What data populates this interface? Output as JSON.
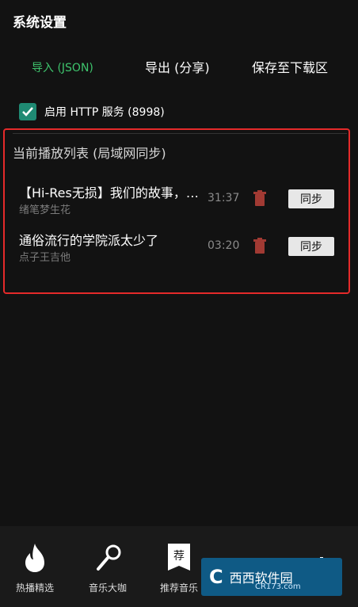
{
  "header": {
    "title": "系统设置"
  },
  "tabs": [
    {
      "label": "导入 (JSON)"
    },
    {
      "label": "导出 (分享)"
    },
    {
      "label": "保存至下载区"
    }
  ],
  "http": {
    "label": "启用 HTTP 服务 (8998)",
    "checked": true
  },
  "playlist": {
    "title": "当前播放列表 (局域网同步)",
    "items": [
      {
        "title": "【Hi-Res无损】我们的故事，…",
        "artist": "绪笔梦生花",
        "duration": "31:37",
        "action": "同步"
      },
      {
        "title": "通俗流行的学院派太少了",
        "artist": "点子王吉他",
        "duration": "03:20",
        "action": "同步"
      }
    ]
  },
  "bottom_nav": [
    {
      "label": "热播精选",
      "icon": "fire-icon"
    },
    {
      "label": "音乐大咖",
      "icon": "microphone-icon"
    },
    {
      "label": "推荐音乐",
      "icon": "recommend-icon"
    },
    {
      "label": "",
      "icon": "star-icon"
    },
    {
      "label": "",
      "icon": "gear-icon"
    }
  ],
  "watermark": {
    "logo_text": "C",
    "brand": "西西软件园",
    "sub": "CR173.com"
  },
  "colors": {
    "accent": "#3ec46d",
    "checkbox": "#1f8a73",
    "highlight": "#e52a2a",
    "trash": "#a13a33"
  }
}
